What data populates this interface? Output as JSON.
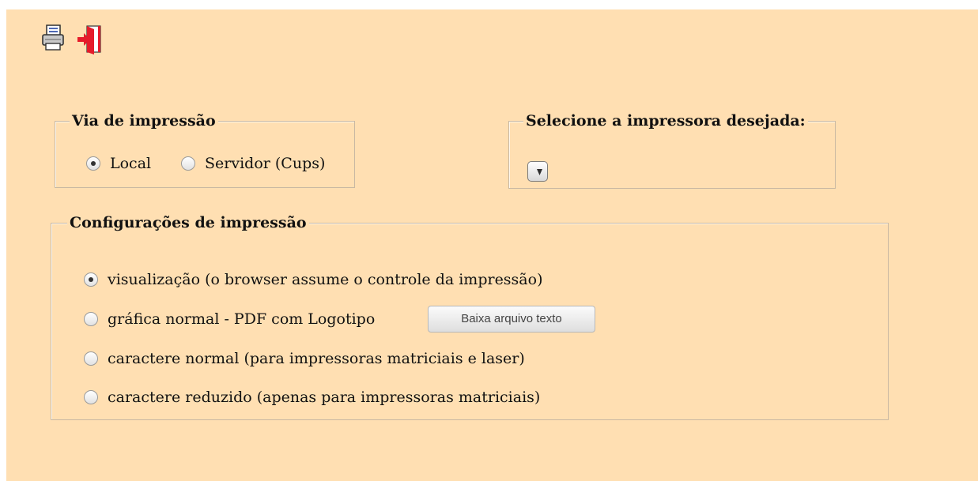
{
  "toolbar": {
    "printer_icon": "printer-icon",
    "exit_icon": "exit-door-icon"
  },
  "print_route": {
    "title": "Via de impressão",
    "options": [
      {
        "label": "Local",
        "selected": true
      },
      {
        "label": "Servidor (Cups)",
        "selected": false
      }
    ]
  },
  "printer_selection": {
    "title": "Selecione a impressora desejada:",
    "selected_printer": ""
  },
  "print_settings": {
    "title": "Configurações de impressão",
    "options": [
      {
        "label": "visualização (o browser assume o controle da impressão)",
        "selected": true
      },
      {
        "label": "gráfica normal - PDF com Logotipo",
        "selected": false
      },
      {
        "label": "caractere normal (para impressoras matriciais e laser)",
        "selected": false
      },
      {
        "label": "caractere reduzido (apenas para impressoras matriciais)",
        "selected": false
      }
    ],
    "download_button_label": "Baixa arquivo texto"
  },
  "colors": {
    "panel_background": "#ffdfb2",
    "icon_red": "#e51b2a"
  }
}
